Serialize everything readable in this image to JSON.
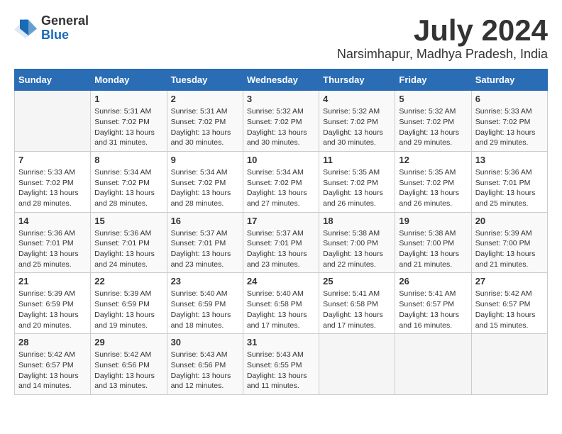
{
  "header": {
    "logo_general": "General",
    "logo_blue": "Blue",
    "month_year": "July 2024",
    "location": "Narsimhapur, Madhya Pradesh, India"
  },
  "weekdays": [
    "Sunday",
    "Monday",
    "Tuesday",
    "Wednesday",
    "Thursday",
    "Friday",
    "Saturday"
  ],
  "weeks": [
    [
      {
        "day": "",
        "content": ""
      },
      {
        "day": "1",
        "content": "Sunrise: 5:31 AM\nSunset: 7:02 PM\nDaylight: 13 hours\nand 31 minutes."
      },
      {
        "day": "2",
        "content": "Sunrise: 5:31 AM\nSunset: 7:02 PM\nDaylight: 13 hours\nand 30 minutes."
      },
      {
        "day": "3",
        "content": "Sunrise: 5:32 AM\nSunset: 7:02 PM\nDaylight: 13 hours\nand 30 minutes."
      },
      {
        "day": "4",
        "content": "Sunrise: 5:32 AM\nSunset: 7:02 PM\nDaylight: 13 hours\nand 30 minutes."
      },
      {
        "day": "5",
        "content": "Sunrise: 5:32 AM\nSunset: 7:02 PM\nDaylight: 13 hours\nand 29 minutes."
      },
      {
        "day": "6",
        "content": "Sunrise: 5:33 AM\nSunset: 7:02 PM\nDaylight: 13 hours\nand 29 minutes."
      }
    ],
    [
      {
        "day": "7",
        "content": "Sunrise: 5:33 AM\nSunset: 7:02 PM\nDaylight: 13 hours\nand 28 minutes."
      },
      {
        "day": "8",
        "content": "Sunrise: 5:34 AM\nSunset: 7:02 PM\nDaylight: 13 hours\nand 28 minutes."
      },
      {
        "day": "9",
        "content": "Sunrise: 5:34 AM\nSunset: 7:02 PM\nDaylight: 13 hours\nand 28 minutes."
      },
      {
        "day": "10",
        "content": "Sunrise: 5:34 AM\nSunset: 7:02 PM\nDaylight: 13 hours\nand 27 minutes."
      },
      {
        "day": "11",
        "content": "Sunrise: 5:35 AM\nSunset: 7:02 PM\nDaylight: 13 hours\nand 26 minutes."
      },
      {
        "day": "12",
        "content": "Sunrise: 5:35 AM\nSunset: 7:02 PM\nDaylight: 13 hours\nand 26 minutes."
      },
      {
        "day": "13",
        "content": "Sunrise: 5:36 AM\nSunset: 7:01 PM\nDaylight: 13 hours\nand 25 minutes."
      }
    ],
    [
      {
        "day": "14",
        "content": "Sunrise: 5:36 AM\nSunset: 7:01 PM\nDaylight: 13 hours\nand 25 minutes."
      },
      {
        "day": "15",
        "content": "Sunrise: 5:36 AM\nSunset: 7:01 PM\nDaylight: 13 hours\nand 24 minutes."
      },
      {
        "day": "16",
        "content": "Sunrise: 5:37 AM\nSunset: 7:01 PM\nDaylight: 13 hours\nand 23 minutes."
      },
      {
        "day": "17",
        "content": "Sunrise: 5:37 AM\nSunset: 7:01 PM\nDaylight: 13 hours\nand 23 minutes."
      },
      {
        "day": "18",
        "content": "Sunrise: 5:38 AM\nSunset: 7:00 PM\nDaylight: 13 hours\nand 22 minutes."
      },
      {
        "day": "19",
        "content": "Sunrise: 5:38 AM\nSunset: 7:00 PM\nDaylight: 13 hours\nand 21 minutes."
      },
      {
        "day": "20",
        "content": "Sunrise: 5:39 AM\nSunset: 7:00 PM\nDaylight: 13 hours\nand 21 minutes."
      }
    ],
    [
      {
        "day": "21",
        "content": "Sunrise: 5:39 AM\nSunset: 6:59 PM\nDaylight: 13 hours\nand 20 minutes."
      },
      {
        "day": "22",
        "content": "Sunrise: 5:39 AM\nSunset: 6:59 PM\nDaylight: 13 hours\nand 19 minutes."
      },
      {
        "day": "23",
        "content": "Sunrise: 5:40 AM\nSunset: 6:59 PM\nDaylight: 13 hours\nand 18 minutes."
      },
      {
        "day": "24",
        "content": "Sunrise: 5:40 AM\nSunset: 6:58 PM\nDaylight: 13 hours\nand 17 minutes."
      },
      {
        "day": "25",
        "content": "Sunrise: 5:41 AM\nSunset: 6:58 PM\nDaylight: 13 hours\nand 17 minutes."
      },
      {
        "day": "26",
        "content": "Sunrise: 5:41 AM\nSunset: 6:57 PM\nDaylight: 13 hours\nand 16 minutes."
      },
      {
        "day": "27",
        "content": "Sunrise: 5:42 AM\nSunset: 6:57 PM\nDaylight: 13 hours\nand 15 minutes."
      }
    ],
    [
      {
        "day": "28",
        "content": "Sunrise: 5:42 AM\nSunset: 6:57 PM\nDaylight: 13 hours\nand 14 minutes."
      },
      {
        "day": "29",
        "content": "Sunrise: 5:42 AM\nSunset: 6:56 PM\nDaylight: 13 hours\nand 13 minutes."
      },
      {
        "day": "30",
        "content": "Sunrise: 5:43 AM\nSunset: 6:56 PM\nDaylight: 13 hours\nand 12 minutes."
      },
      {
        "day": "31",
        "content": "Sunrise: 5:43 AM\nSunset: 6:55 PM\nDaylight: 13 hours\nand 11 minutes."
      },
      {
        "day": "",
        "content": ""
      },
      {
        "day": "",
        "content": ""
      },
      {
        "day": "",
        "content": ""
      }
    ]
  ]
}
